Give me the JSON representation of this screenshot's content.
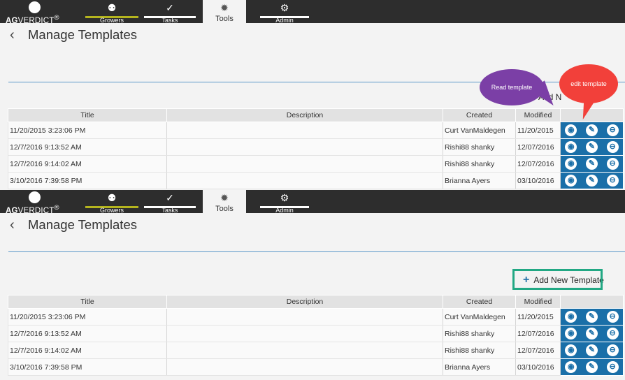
{
  "nav": {
    "logo_text_bold": "AG",
    "logo_text": "VERDICT",
    "logo_tm": "®",
    "tabs": [
      {
        "label": "Growers",
        "icon": "⚉"
      },
      {
        "label": "Tasks",
        "icon": "✓"
      },
      {
        "label": "Tools",
        "icon": "✹"
      },
      {
        "label": "Admin",
        "icon": "⚙"
      }
    ]
  },
  "page": {
    "back_glyph": "‹",
    "title": "Manage Templates",
    "add_button_label": "Add New Template",
    "add_button_partial": "Add N",
    "plus_glyph": "+"
  },
  "table": {
    "columns": [
      "Title",
      "Description",
      "Created",
      "Modified",
      ""
    ],
    "rows": [
      {
        "title": "11/20/2015 3:23:06 PM",
        "description": "",
        "created": "Curt VanMaldegen",
        "modified": "11/20/2015"
      },
      {
        "title": "12/7/2016 9:13:52 AM",
        "description": "",
        "created": "Rishi88 shanky",
        "modified": "12/07/2016"
      },
      {
        "title": "12/7/2016 9:14:02 AM",
        "description": "",
        "created": "Rishi88 shanky",
        "modified": "12/07/2016"
      },
      {
        "title": "3/10/2016 7:39:58 PM",
        "description": "",
        "created": "Brianna Ayers",
        "modified": "03/10/2016"
      }
    ],
    "action_icons": {
      "read": "◉",
      "edit": "✎",
      "delete": "⊖"
    }
  },
  "annotations": {
    "read_bubble": "Read template",
    "edit_bubble": "edit template"
  },
  "colors": {
    "nav_bg": "#2d2d2d",
    "growers_accent": "#b4b41e",
    "action_blue": "#1a6fa8",
    "read_bubble": "#7b3fa6",
    "edit_bubble": "#f2403a",
    "highlight": "#22a884"
  }
}
